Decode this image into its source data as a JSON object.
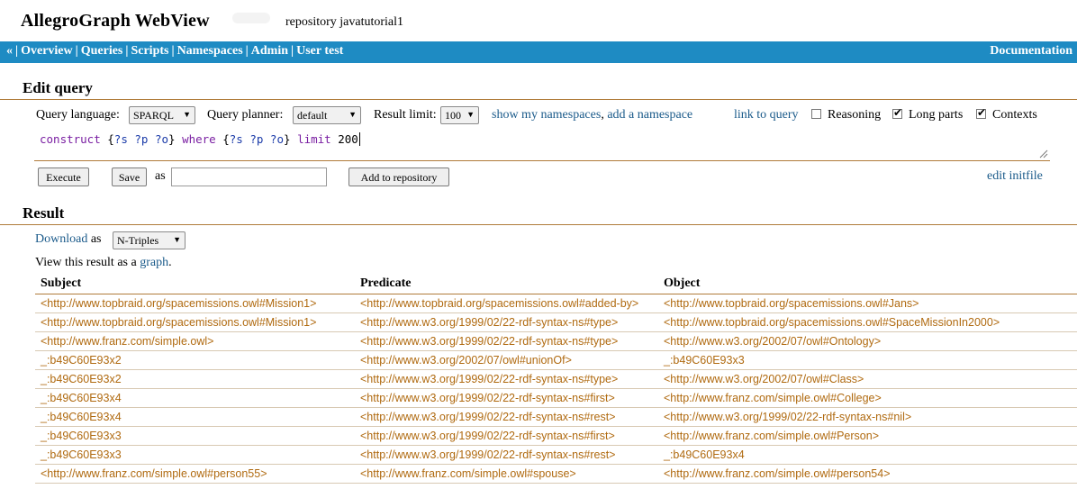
{
  "header": {
    "app_title": "AllegroGraph WebView",
    "repository_label": "repository javatutorial1"
  },
  "nav": {
    "back": "«",
    "items": [
      "Overview",
      "Queries",
      "Scripts",
      "Namespaces",
      "Admin",
      "User test"
    ],
    "documentation": "Documentation"
  },
  "edit_query": {
    "title": "Edit query",
    "language_label": "Query language:",
    "language_value": "SPARQL",
    "planner_label": "Query planner:",
    "planner_value": "default",
    "limit_label": "Result limit:",
    "limit_value": "100",
    "show_namespaces": "show my namespaces",
    "comma": ",",
    "add_namespace": "add a namespace",
    "link_to_query": "link to query",
    "reasoning_label": "Reasoning",
    "reasoning_checked": false,
    "long_parts_label": "Long parts",
    "long_parts_checked": true,
    "contexts_label": "Contexts",
    "contexts_checked": true,
    "query_text": "construct {?s ?p ?o} where {?s ?p ?o} limit 200",
    "execute_label": "Execute",
    "save_label": "Save",
    "as_label": "as",
    "save_input_value": "",
    "add_to_repo_label": "Add to repository",
    "edit_initfile": "edit initfile"
  },
  "result": {
    "title": "Result",
    "download_label": "Download",
    "as_label": "as",
    "format_value": "N-Triples",
    "view_prefix": "View this result as a ",
    "graph_link": "graph",
    "view_suffix": ".",
    "columns": [
      "Subject",
      "Predicate",
      "Object"
    ],
    "rows": [
      [
        "<http://www.topbraid.org/spacemissions.owl#Mission1>",
        "<http://www.topbraid.org/spacemissions.owl#added-by>",
        "<http://www.topbraid.org/spacemissions.owl#Jans>"
      ],
      [
        "<http://www.topbraid.org/spacemissions.owl#Mission1>",
        "<http://www.w3.org/1999/02/22-rdf-syntax-ns#type>",
        "<http://www.topbraid.org/spacemissions.owl#SpaceMissionIn2000>"
      ],
      [
        "<http://www.franz.com/simple.owl>",
        "<http://www.w3.org/1999/02/22-rdf-syntax-ns#type>",
        "<http://www.w3.org/2002/07/owl#Ontology>"
      ],
      [
        "_:b49C60E93x2",
        "<http://www.w3.org/2002/07/owl#unionOf>",
        "_:b49C60E93x3"
      ],
      [
        "_:b49C60E93x2",
        "<http://www.w3.org/1999/02/22-rdf-syntax-ns#type>",
        "<http://www.w3.org/2002/07/owl#Class>"
      ],
      [
        "_:b49C60E93x4",
        "<http://www.w3.org/1999/02/22-rdf-syntax-ns#first>",
        "<http://www.franz.com/simple.owl#College>"
      ],
      [
        "_:b49C60E93x4",
        "<http://www.w3.org/1999/02/22-rdf-syntax-ns#rest>",
        "<http://www.w3.org/1999/02/22-rdf-syntax-ns#nil>"
      ],
      [
        "_:b49C60E93x3",
        "<http://www.w3.org/1999/02/22-rdf-syntax-ns#first>",
        "<http://www.franz.com/simple.owl#Person>"
      ],
      [
        "_:b49C60E93x3",
        "<http://www.w3.org/1999/02/22-rdf-syntax-ns#rest>",
        "_:b49C60E93x4"
      ],
      [
        "<http://www.franz.com/simple.owl#person55>",
        "<http://www.franz.com/simple.owl#spouse>",
        "<http://www.franz.com/simple.owl#person54>"
      ]
    ]
  },
  "colors": {
    "nav_bg": "#1e8bc3",
    "link": "#1a5a8a",
    "result_text": "#b06a10",
    "rule": "#b07b3a"
  }
}
